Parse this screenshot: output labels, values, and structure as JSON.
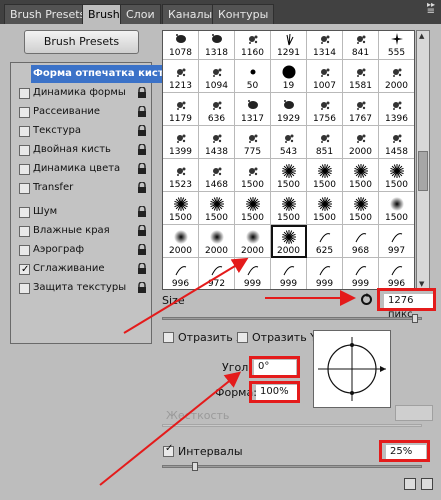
{
  "tabs": [
    "Brush Presets",
    "Brush",
    "Слои",
    "Каналы",
    "Контуры"
  ],
  "preset_button": "Brush Presets",
  "left_list": [
    {
      "label": "Форма отпечатка кисти",
      "checkbox": false,
      "lock": false,
      "selected": true
    },
    {
      "label": "Динамика формы",
      "checkbox": true,
      "checked": false,
      "lock": true
    },
    {
      "label": "Рассеивание",
      "checkbox": true,
      "checked": false,
      "lock": true
    },
    {
      "label": "Текстура",
      "checkbox": true,
      "checked": false,
      "lock": true
    },
    {
      "label": "Двойная кисть",
      "checkbox": true,
      "checked": false,
      "lock": true
    },
    {
      "label": "Динамика цвета",
      "checkbox": true,
      "checked": false,
      "lock": true
    },
    {
      "label": "Transfer",
      "checkbox": true,
      "checked": false,
      "lock": true
    },
    {
      "label": "Шум",
      "checkbox": true,
      "checked": false,
      "lock": true
    },
    {
      "label": "Влажные края",
      "checkbox": true,
      "checked": false,
      "lock": true
    },
    {
      "label": "Аэрограф",
      "checkbox": true,
      "checked": false,
      "lock": true
    },
    {
      "label": "Сглаживание",
      "checkbox": true,
      "checked": true,
      "lock": true
    },
    {
      "label": "Защита текстуры",
      "checkbox": true,
      "checked": false,
      "lock": true
    }
  ],
  "brush_grid": [
    [
      "1078",
      "1318",
      "1160",
      "1291",
      "1314",
      "841",
      "555"
    ],
    [
      "1213",
      "1094",
      "50",
      "19",
      "1007",
      "1581",
      "2000"
    ],
    [
      "1179",
      "636",
      "1317",
      "1929",
      "1756",
      "1767",
      "1396"
    ],
    [
      "1399",
      "1438",
      "775",
      "543",
      "851",
      "2000",
      "1458"
    ],
    [
      "1523",
      "1468",
      "1500",
      "1500",
      "1500",
      "1500",
      "1500"
    ],
    [
      "1500",
      "1500",
      "1500",
      "1500",
      "1500",
      "1500",
      "1500"
    ],
    [
      "2000",
      "2000",
      "2000",
      "2000",
      "625",
      "968",
      "997"
    ],
    [
      "996",
      "972",
      "999",
      "999",
      "999",
      "999",
      "996"
    ],
    [
      "",
      "",
      "",
      "",
      "",
      "",
      ""
    ]
  ],
  "brush_thumbs": [
    [
      "blob",
      "blob",
      "splat",
      "grass",
      "splat",
      "splat",
      "sparkle"
    ],
    [
      "splat",
      "splat",
      "dot",
      "circle",
      "splat",
      "splat",
      "splat"
    ],
    [
      "splat",
      "splat",
      "blob",
      "blob",
      "splat",
      "splat",
      "splat"
    ],
    [
      "splat",
      "splat",
      "splat",
      "splat",
      "splat",
      "splat",
      "splat"
    ],
    [
      "splat",
      "splat",
      "splat",
      "burst",
      "burst",
      "burst",
      "burst"
    ],
    [
      "burst",
      "burst",
      "burst",
      "burst",
      "burst",
      "burst",
      "soft"
    ],
    [
      "soft",
      "soft",
      "soft",
      "burst",
      "strand",
      "strand",
      "strand"
    ],
    [
      "strand",
      "strand",
      "strand",
      "strand",
      "strand",
      "strand",
      "strand"
    ],
    [
      "strand",
      "strand",
      "strand",
      "strand",
      "strand",
      "strand",
      "strand"
    ]
  ],
  "size_label": "Size",
  "size_value": "1276 пикс",
  "flip_x": "Отразить X",
  "flip_y": "Отразить Y",
  "angle_label": "Угол:",
  "angle_value": "0°",
  "roundness_label": "Форма:",
  "roundness_value": "100%",
  "hardness_label": "Жесткость",
  "spacing_label": "Интервалы",
  "spacing_value": "25%",
  "spacing_checked": true,
  "colors": {
    "highlight": "#e41b1b",
    "selection": "#3b72c8"
  }
}
